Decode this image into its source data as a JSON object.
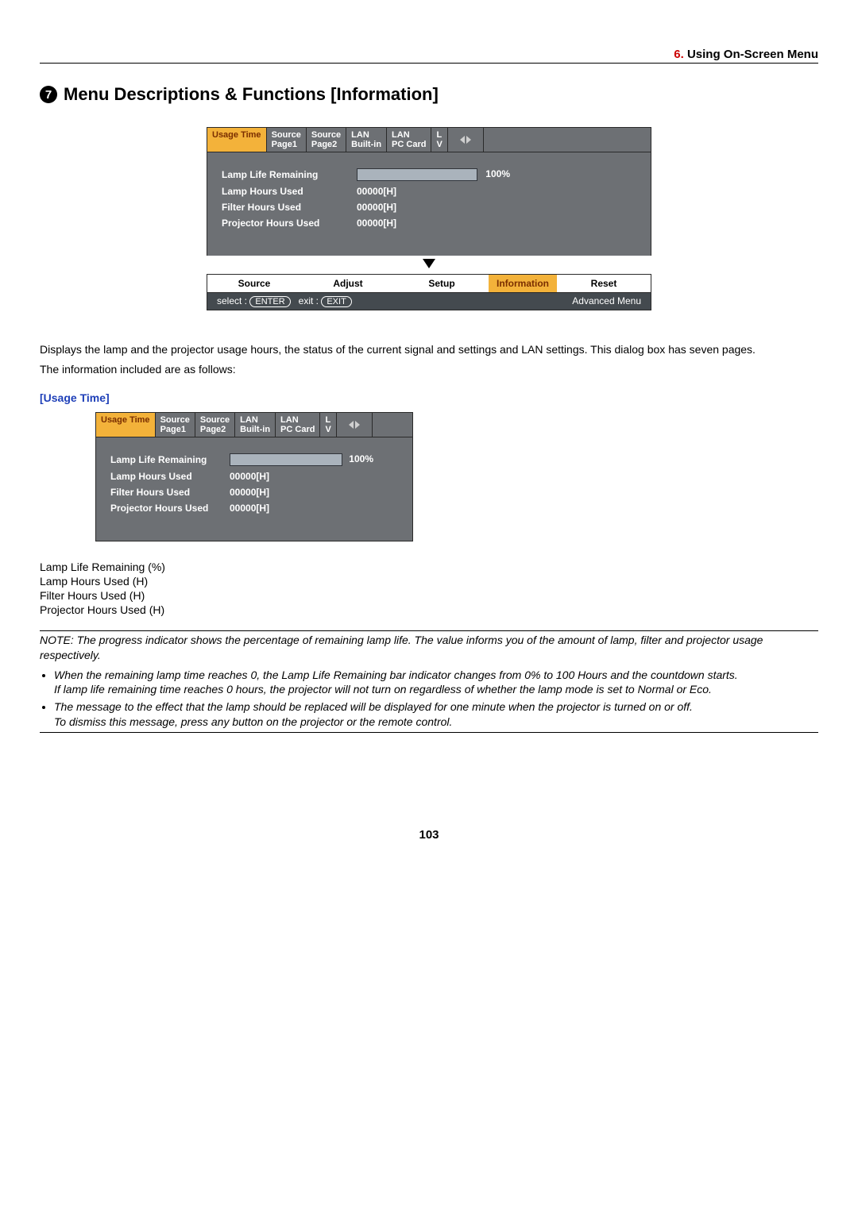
{
  "header": {
    "section_num": "6.",
    "section_title": "Using On-Screen Menu"
  },
  "title": {
    "bullet_num": "7",
    "text": "Menu Descriptions & Functions [Information]"
  },
  "tabs": {
    "usage_time": "Usage Time",
    "source_page1_l1": "Source",
    "source_page1_l2": "Page1",
    "source_page2_l1": "Source",
    "source_page2_l2": "Page2",
    "lan_builtin_l1": "LAN",
    "lan_builtin_l2": "Built-in",
    "lan_pccard_l1": "LAN",
    "lan_pccard_l2": "PC Card",
    "partial_l1": "L",
    "partial_l2": "V"
  },
  "osd": {
    "lamp_life_label": "Lamp Life Remaining",
    "lamp_life_percent": "100%",
    "lamp_hours_label": "Lamp Hours Used",
    "lamp_hours_value": "00000[H]",
    "filter_hours_label": "Filter Hours Used",
    "filter_hours_value": "00000[H]",
    "projector_hours_label": "Projector Hours Used",
    "projector_hours_value": "00000[H]"
  },
  "footer_nav": {
    "source": "Source",
    "adjust": "Adjust",
    "setup": "Setup",
    "information": "Information",
    "reset": "Reset"
  },
  "footer_bar": {
    "select_label": "select :",
    "select_key": "ENTER",
    "exit_label": "exit :",
    "exit_key": "EXIT",
    "right": "Advanced Menu"
  },
  "body_text": {
    "p1": "Displays the lamp and the projector usage hours, the status of the current signal and settings and LAN settings. This dialog box has seven pages.",
    "p2": "The information included are as follows:",
    "subhead": "[Usage Time]",
    "list1": "Lamp Life Remaining (%)",
    "list2": "Lamp Hours Used (H)",
    "list3": "Filter Hours Used (H)",
    "list4": "Projector Hours Used (H)",
    "note_lead": "NOTE: The progress indicator shows the percentage of remaining lamp life. The value informs you of the amount of lamp, filter and projector usage respectively.",
    "bul1a": "When the remaining lamp time reaches 0, the Lamp Life Remaining bar indicator changes from 0% to 100 Hours and the countdown starts.",
    "bul1b": "If lamp life remaining time reaches 0 hours, the projector will not turn on regardless of whether the lamp mode is set to Normal or Eco.",
    "bul2a": "The message to the effect that the lamp should be replaced will be displayed for one minute when the projector is turned on or off.",
    "bul2b": "To dismiss this message, press any button on the projector or the remote control."
  },
  "page_number": "103",
  "chart_data": {
    "type": "bar",
    "categories": [
      "Lamp Life Remaining"
    ],
    "values": [
      100
    ],
    "xlabel": "",
    "ylabel": "%",
    "ylim": [
      0,
      100
    ],
    "title": "Lamp Life Remaining progress indicator"
  }
}
